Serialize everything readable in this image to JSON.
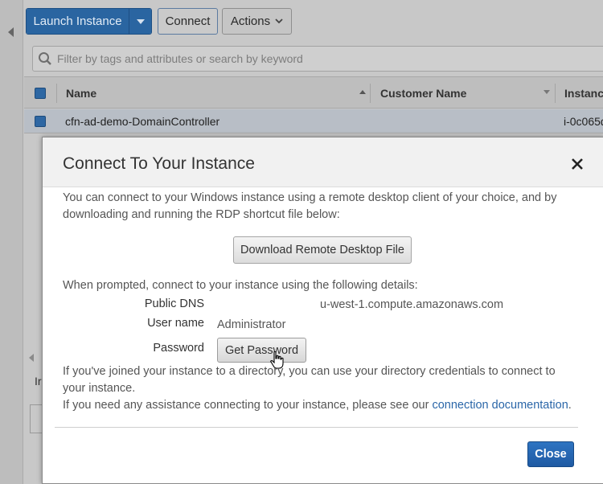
{
  "toolbar": {
    "launch_label": "Launch Instance",
    "connect_label": "Connect",
    "actions_label": "Actions"
  },
  "search": {
    "placeholder": "Filter by tags and attributes or search by keyword"
  },
  "table": {
    "columns": [
      "Name",
      "Customer Name",
      "Instance"
    ],
    "rows": [
      {
        "name": "cfn-ad-demo-DomainController",
        "instance": "i-0c065d"
      }
    ]
  },
  "lower_panel": {
    "tab_fragment": "Ir"
  },
  "modal": {
    "title": "Connect To Your Instance",
    "intro": "You can connect to your Windows instance using a remote desktop client of your choice, and by downloading and running the RDP shortcut file below:",
    "download_label": "Download Remote Desktop File",
    "prompt": "When prompted, connect to your instance using the following details:",
    "details": {
      "dns_label": "Public DNS",
      "dns_value": "u-west-1.compute.amazonaws.com",
      "user_label": "User name",
      "user_value": "Administrator",
      "password_label": "Password",
      "get_password_label": "Get Password"
    },
    "directory_note": "If you've joined your instance to a directory, you can use your directory credentials to connect to your instance.",
    "assist_prefix": "If you need any assistance connecting to your instance, please see our",
    "assist_link": "connection documentation",
    "assist_suffix": ".",
    "close_label": "Close"
  },
  "colors": {
    "primary": "#2a65a1",
    "close_button": "#1f5aa3",
    "link": "#2a66a8"
  },
  "icons": [
    "chevron-left-icon",
    "caret-down-icon",
    "search-icon",
    "close-icon",
    "hand-cursor-icon"
  ]
}
